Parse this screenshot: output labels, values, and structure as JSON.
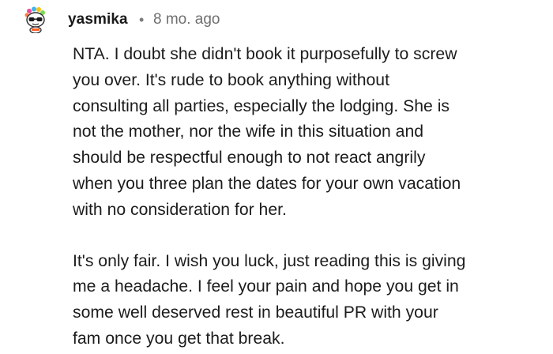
{
  "comment": {
    "author": "yasmika",
    "separator": "•",
    "age": "8 mo. ago",
    "avatar_icon": "snoo-avatar-icon",
    "paragraph_1": [
      "NTA. I doubt she didn't book it purposefully to screw",
      "you over. It's rude to book anything without",
      "consulting all parties, especially the lodging. She is",
      "not the mother, nor the wife in this situation and",
      "should be respectful enough to not react angrily",
      "when you three plan the dates for your own vacation",
      "with no consideration for her."
    ],
    "paragraph_2": [
      "It's only fair. I wish you luck, just reading this is giving",
      "me a headache. I feel your pain and hope you get in",
      "some well deserved rest in beautiful PR with your",
      "fam once you get that break."
    ]
  }
}
